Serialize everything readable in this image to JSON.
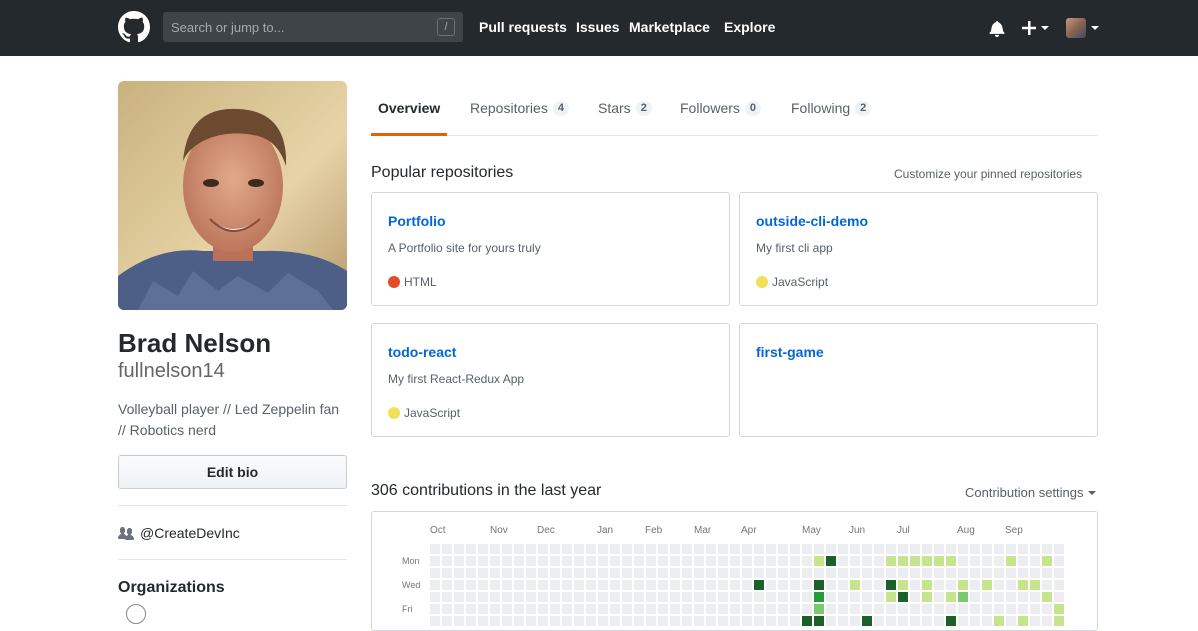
{
  "header": {
    "search_placeholder": "Search or jump to...",
    "search_hint": "/",
    "nav": [
      "Pull requests",
      "Issues",
      "Marketplace",
      "Explore"
    ]
  },
  "profile": {
    "fullname": "Brad Nelson",
    "username": "fullnelson14",
    "bio_line1": "Volleyball player // Led Zeppelin fan",
    "bio_line2": "// Robotics nerd",
    "edit_bio": "Edit bio",
    "org_handle": "@CreateDevInc",
    "organizations_title": "Organizations"
  },
  "tabs": [
    {
      "label": "Overview",
      "count": ""
    },
    {
      "label": "Repositories",
      "count": "4"
    },
    {
      "label": "Stars",
      "count": "2"
    },
    {
      "label": "Followers",
      "count": "0"
    },
    {
      "label": "Following",
      "count": "2"
    }
  ],
  "popular": {
    "title": "Popular repositories",
    "customize": "Customize your pinned repositories",
    "repos": [
      {
        "name": "Portfolio",
        "desc": "A Portfolio site for yours truly",
        "lang": "HTML",
        "lang_color": "#e34c26"
      },
      {
        "name": "outside-cli-demo",
        "desc": "My first cli app",
        "lang": "JavaScript",
        "lang_color": "#f1e05a"
      },
      {
        "name": "todo-react",
        "desc": "My first React-Redux App",
        "lang": "JavaScript",
        "lang_color": "#f1e05a"
      },
      {
        "name": "first-game",
        "desc": "",
        "lang": "",
        "lang_color": ""
      }
    ]
  },
  "contributions": {
    "title": "306 contributions in the last year",
    "settings": "Contribution settings",
    "months": [
      "Oct",
      "Nov",
      "Dec",
      "Jan",
      "Feb",
      "Mar",
      "Apr",
      "May",
      "Jun",
      "Jul",
      "Aug",
      "Sep"
    ],
    "weekdays": [
      "Mon",
      "Wed",
      "Fri"
    ],
    "level_colors": [
      "#ebedf0",
      "#c6e48b",
      "#7bc96f",
      "#239a3b",
      "#196127"
    ],
    "levels": [
      [
        0,
        0,
        0,
        0,
        0,
        0,
        0,
        0,
        0,
        0,
        0,
        0,
        0,
        0,
        0,
        0,
        0,
        0,
        0,
        0,
        0,
        0,
        0,
        0,
        0,
        0,
        0,
        0,
        0,
        0,
        0,
        0,
        0,
        0,
        0,
        0,
        0,
        0,
        0,
        0,
        0,
        0,
        0,
        0,
        0,
        0,
        0,
        0,
        0,
        0,
        0,
        0,
        0
      ],
      [
        0,
        0,
        0,
        0,
        0,
        0,
        0,
        0,
        0,
        0,
        0,
        0,
        0,
        0,
        0,
        0,
        0,
        0,
        0,
        0,
        0,
        0,
        0,
        0,
        0,
        0,
        0,
        0,
        0,
        0,
        0,
        0,
        1,
        4,
        0,
        0,
        0,
        0,
        1,
        1,
        1,
        1,
        1,
        1,
        0,
        0,
        0,
        0,
        1,
        0,
        0,
        1,
        0
      ],
      [
        0,
        0,
        0,
        0,
        0,
        0,
        0,
        0,
        0,
        0,
        0,
        0,
        0,
        0,
        0,
        0,
        0,
        0,
        0,
        0,
        0,
        0,
        0,
        0,
        0,
        0,
        0,
        0,
        0,
        0,
        0,
        0,
        0,
        0,
        0,
        0,
        0,
        0,
        0,
        0,
        0,
        0,
        0,
        0,
        0,
        0,
        0,
        0,
        0,
        0,
        0,
        0,
        0
      ],
      [
        0,
        0,
        0,
        0,
        0,
        0,
        0,
        0,
        0,
        0,
        0,
        0,
        0,
        0,
        0,
        0,
        0,
        0,
        0,
        0,
        0,
        0,
        0,
        0,
        0,
        0,
        0,
        4,
        0,
        0,
        0,
        0,
        4,
        0,
        0,
        1,
        0,
        0,
        4,
        1,
        0,
        1,
        0,
        0,
        1,
        0,
        1,
        0,
        0,
        1,
        1,
        0,
        0
      ],
      [
        0,
        0,
        0,
        0,
        0,
        0,
        0,
        0,
        0,
        0,
        0,
        0,
        0,
        0,
        0,
        0,
        0,
        0,
        0,
        0,
        0,
        0,
        0,
        0,
        0,
        0,
        0,
        0,
        0,
        0,
        0,
        0,
        3,
        0,
        0,
        0,
        0,
        0,
        1,
        4,
        0,
        1,
        0,
        1,
        2,
        0,
        0,
        0,
        0,
        0,
        0,
        1,
        0
      ],
      [
        0,
        0,
        0,
        0,
        0,
        0,
        0,
        0,
        0,
        0,
        0,
        0,
        0,
        0,
        0,
        0,
        0,
        0,
        0,
        0,
        0,
        0,
        0,
        0,
        0,
        0,
        0,
        0,
        0,
        0,
        0,
        0,
        2,
        0,
        0,
        0,
        0,
        0,
        0,
        0,
        0,
        0,
        0,
        0,
        0,
        0,
        0,
        0,
        0,
        0,
        0,
        0,
        1
      ],
      [
        0,
        0,
        0,
        0,
        0,
        0,
        0,
        0,
        0,
        0,
        0,
        0,
        0,
        0,
        0,
        0,
        0,
        0,
        0,
        0,
        0,
        0,
        0,
        0,
        0,
        0,
        0,
        0,
        0,
        0,
        0,
        4,
        4,
        0,
        0,
        0,
        4,
        0,
        0,
        0,
        0,
        0,
        0,
        4,
        0,
        0,
        0,
        1,
        0,
        1,
        0,
        0,
        1
      ]
    ]
  }
}
